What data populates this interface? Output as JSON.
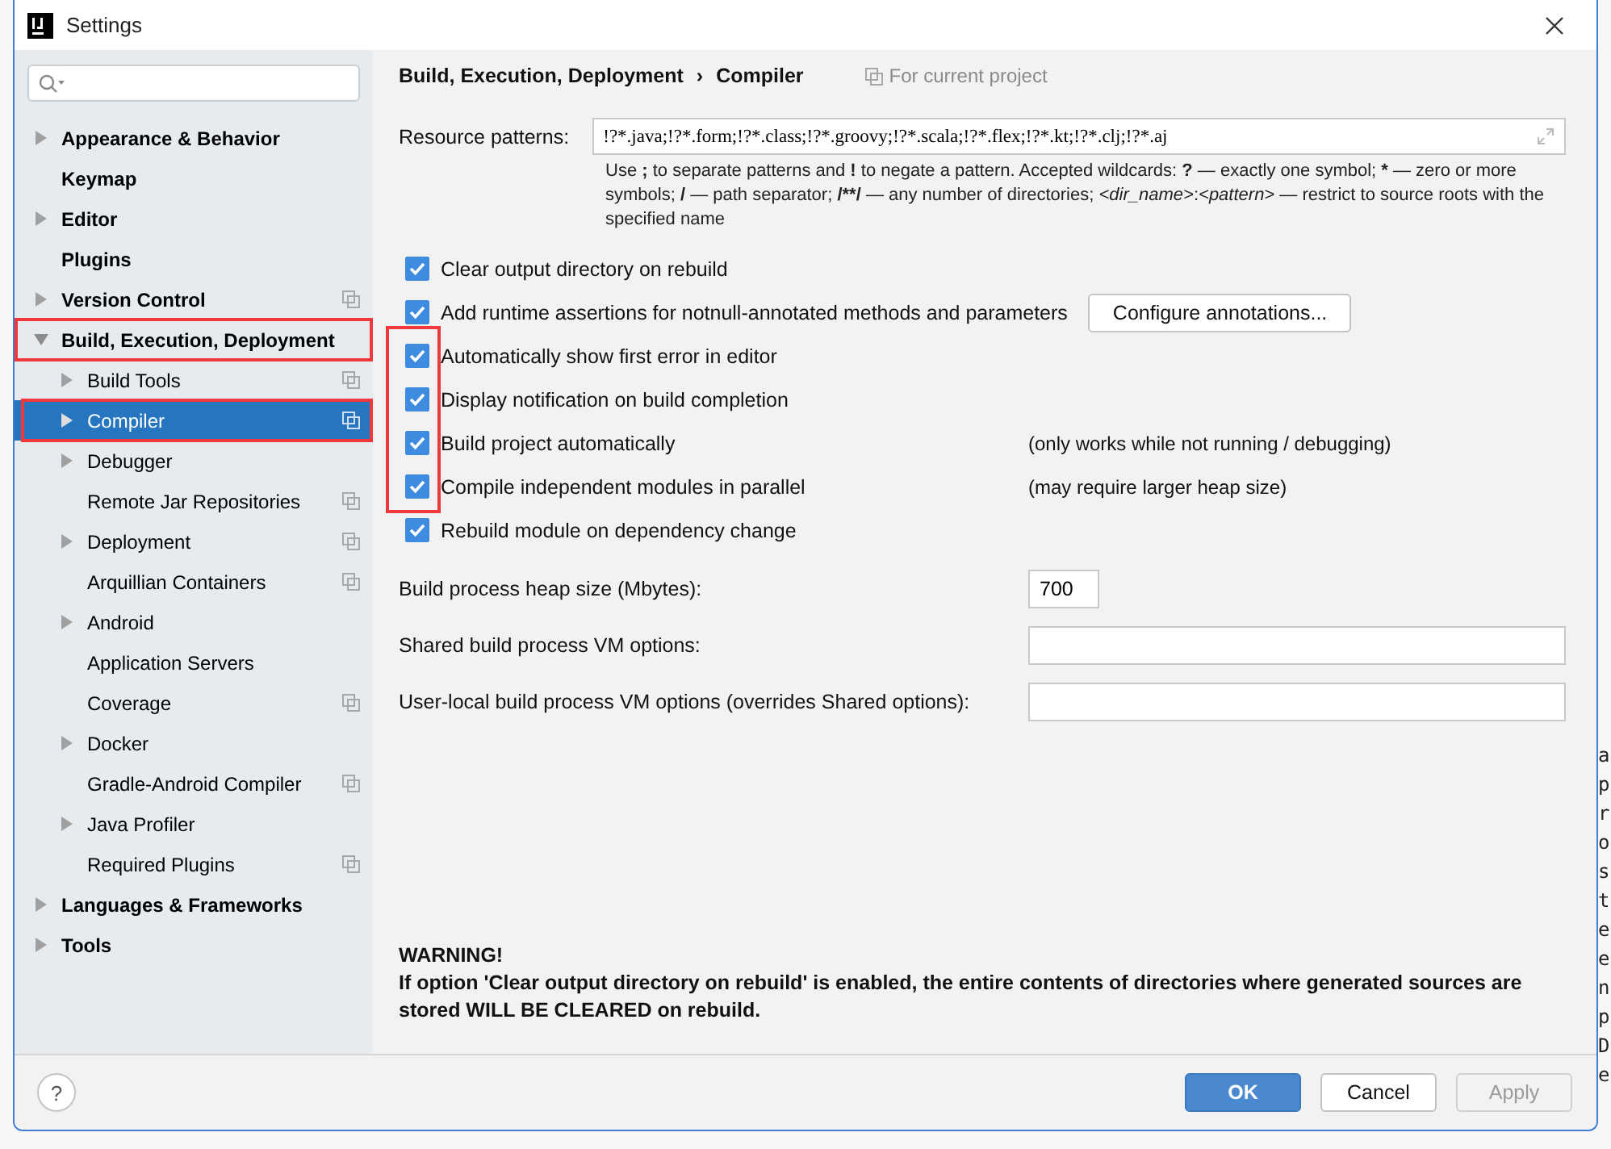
{
  "window": {
    "title": "Settings"
  },
  "sidebar": {
    "items": [
      {
        "label": "Appearance & Behavior",
        "expanded": false,
        "selected": false
      },
      {
        "label": "Keymap",
        "selected": false
      },
      {
        "label": "Editor",
        "expanded": false,
        "selected": false
      },
      {
        "label": "Plugins",
        "selected": false
      },
      {
        "label": "Version Control",
        "expanded": false,
        "selected": false,
        "project_scope": true
      },
      {
        "label": "Build, Execution, Deployment",
        "expanded": true,
        "selected": false,
        "annotated": true,
        "children": [
          {
            "label": "Build Tools",
            "expanded": false,
            "selected": false,
            "project_scope": true
          },
          {
            "label": "Compiler",
            "expanded": false,
            "selected": true,
            "project_scope": true,
            "annotated": true
          },
          {
            "label": "Debugger",
            "expanded": false,
            "selected": false
          },
          {
            "label": "Remote Jar Repositories",
            "selected": false,
            "project_scope": true
          },
          {
            "label": "Deployment",
            "expanded": false,
            "selected": false,
            "project_scope": true
          },
          {
            "label": "Arquillian Containers",
            "selected": false,
            "project_scope": true
          },
          {
            "label": "Android",
            "expanded": false,
            "selected": false
          },
          {
            "label": "Application Servers",
            "selected": false
          },
          {
            "label": "Coverage",
            "selected": false,
            "project_scope": true
          },
          {
            "label": "Docker",
            "expanded": false,
            "selected": false
          },
          {
            "label": "Gradle-Android Compiler",
            "selected": false,
            "project_scope": true
          },
          {
            "label": "Java Profiler",
            "expanded": false,
            "selected": false
          },
          {
            "label": "Required Plugins",
            "selected": false,
            "project_scope": true
          }
        ]
      },
      {
        "label": "Languages & Frameworks",
        "expanded": false,
        "selected": false
      },
      {
        "label": "Tools",
        "expanded": false,
        "selected": false
      }
    ]
  },
  "content": {
    "breadcrumb": [
      "Build, Execution, Deployment",
      "Compiler"
    ],
    "breadcrumb_separator": "›",
    "scope": "For current project",
    "resource_patterns": {
      "label": "Resource patterns:",
      "value": "!?*.java;!?*.form;!?*.class;!?*.groovy;!?*.scala;!?*.flex;!?*.kt;!?*.clj;!?*.aj"
    },
    "hint": [
      {
        "text": "Use ",
        "kind": "plain"
      },
      {
        "text": ";",
        "kind": "bold"
      },
      {
        "text": " to separate patterns and ",
        "kind": "plain"
      },
      {
        "text": "!",
        "kind": "bold"
      },
      {
        "text": " to negate a pattern. Accepted wildcards: ",
        "kind": "plain"
      },
      {
        "text": "?",
        "kind": "bold"
      },
      {
        "text": " — exactly one symbol; ",
        "kind": "plain"
      },
      {
        "text": "*",
        "kind": "bold"
      },
      {
        "text": " — zero or more symbols; ",
        "kind": "plain"
      },
      {
        "text": "/",
        "kind": "bold"
      },
      {
        "text": " — path separator; ",
        "kind": "plain"
      },
      {
        "text": "/**/",
        "kind": "bold"
      },
      {
        "text": " — any number of directories;  ",
        "kind": "plain"
      },
      {
        "text": "<dir_name>",
        "kind": "italic"
      },
      {
        "text": ":",
        "kind": "plain"
      },
      {
        "text": "<pattern>",
        "kind": "italic"
      },
      {
        "text": " — restrict to source roots with the specified name",
        "kind": "plain"
      }
    ],
    "options": [
      {
        "label": "Clear output directory on rebuild",
        "checked": true
      },
      {
        "label": "Add runtime assertions for notnull-annotated methods and parameters",
        "checked": true,
        "button": "Configure annotations..."
      },
      {
        "label": "Automatically show first error in editor",
        "checked": true,
        "annotated": true
      },
      {
        "label": "Display notification on build completion",
        "checked": true,
        "annotated": true
      },
      {
        "label": "Build project automatically",
        "checked": true,
        "annotated": true,
        "note": "(only works while not running / debugging)"
      },
      {
        "label": "Compile independent modules in parallel",
        "checked": true,
        "annotated": true,
        "note": "(may require larger heap size)"
      },
      {
        "label": "Rebuild module on dependency change",
        "checked": true
      }
    ],
    "fields": [
      {
        "label": "Build process heap size (Mbytes):",
        "value": "700",
        "kind": "short"
      },
      {
        "label": "Shared build process VM options:",
        "kind": "wide"
      },
      {
        "label": "User-local build process VM options (overrides Shared options):",
        "kind": "wide"
      }
    ],
    "warning": {
      "title": "WARNING!",
      "text": "If option 'Clear output directory on rebuild' is enabled, the entire contents of directories where generated sources are stored WILL BE CLEARED on rebuild."
    }
  },
  "footer": {
    "help": "?",
    "buttons": [
      {
        "label": "OK",
        "kind": "primary",
        "disabled": false
      },
      {
        "label": "Cancel",
        "kind": "normal",
        "disabled": false
      },
      {
        "label": "Apply",
        "kind": "normal",
        "disabled": true
      }
    ]
  },
  "background_text": [
    "a",
    "p",
    "r",
    "o",
    "s",
    "t",
    "e",
    "e",
    "n",
    "p",
    "D",
    "e"
  ]
}
